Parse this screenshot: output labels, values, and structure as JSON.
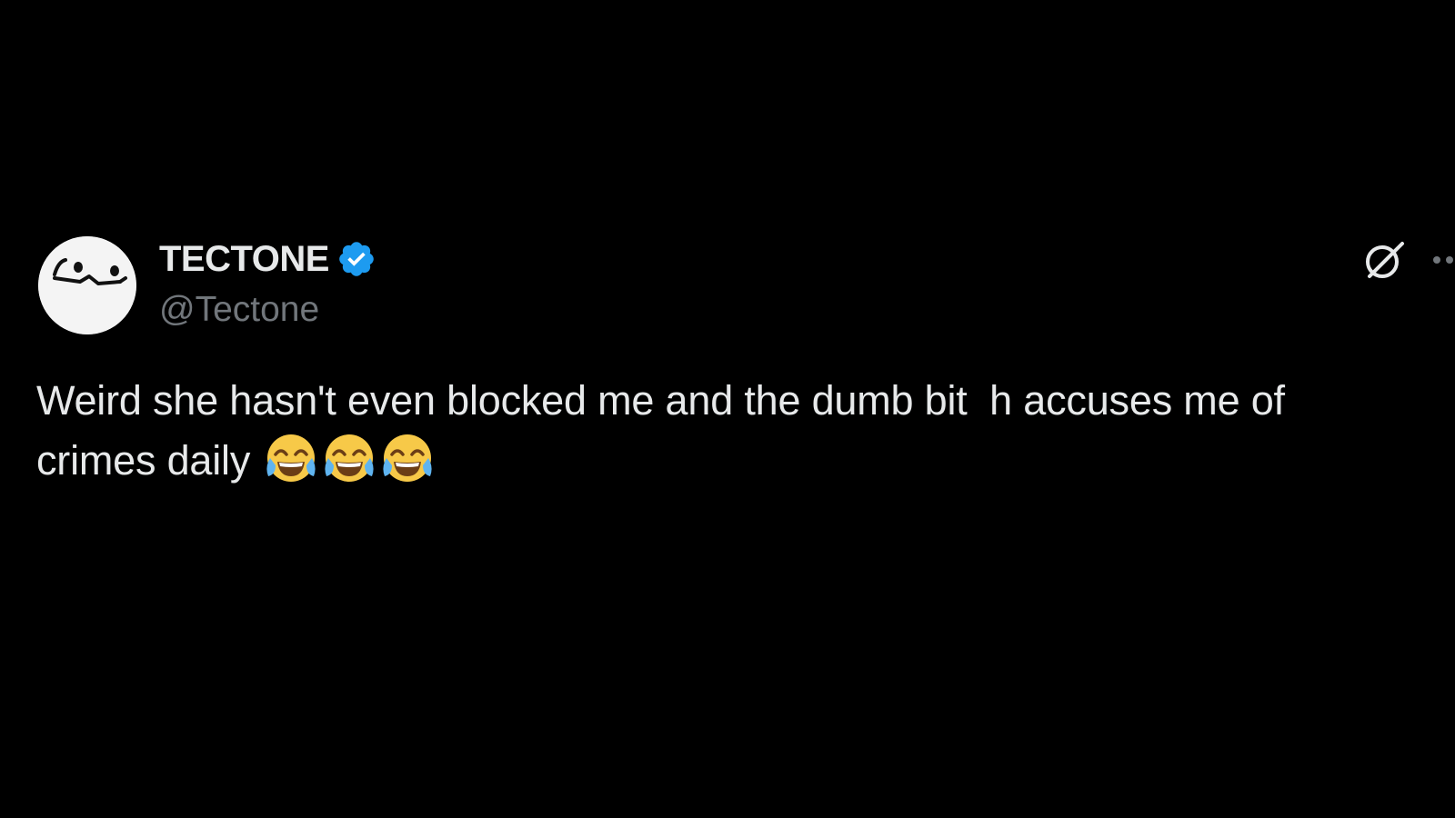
{
  "tweet": {
    "author": {
      "display_name": "TECTONE",
      "handle": "@Tectone",
      "verified": true,
      "avatar_icon": "smiley-avatar-icon",
      "verified_color": "#1d9bf0"
    },
    "text_line_1": "Weird she hasn't even blocked me and the dumb bit  h accuses me of",
    "text_line_2": "crimes daily ",
    "emojis": [
      "face-with-tears-of-joy",
      "face-with-tears-of-joy",
      "face-with-tears-of-joy"
    ],
    "actions": {
      "grok_icon": "grok-icon",
      "more_icon": "more-options-icon"
    }
  },
  "colors": {
    "background": "#000000",
    "primary_text": "#e7e9ea",
    "secondary_text": "#71767b",
    "accent": "#1d9bf0"
  }
}
